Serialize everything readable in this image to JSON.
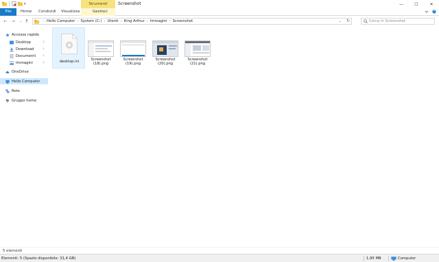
{
  "titlebar": {
    "contextual_tab": "Strumenti immagini",
    "window_title": "Screenshot",
    "minimize": "—",
    "maximize": "☐",
    "close": "✕"
  },
  "ribbon": {
    "tabs": [
      {
        "label": "File"
      },
      {
        "label": "Home"
      },
      {
        "label": "Condividi"
      },
      {
        "label": "Visualizza"
      },
      {
        "label": "Gestisci"
      }
    ]
  },
  "address": {
    "back": "←",
    "forward": "→",
    "recent": "⌄",
    "up": "↑",
    "crumbs": [
      "Hello Computer",
      "System (C:)",
      "Utenti",
      "King Arthur",
      "Immagini",
      "Screenshot"
    ],
    "refresh": "↻",
    "dropdown": "⌄"
  },
  "search": {
    "placeholder": "Cerca in Screenshot"
  },
  "nav": {
    "items": [
      {
        "label": "Accesso rapido",
        "icon": "star-icon"
      },
      {
        "label": "Desktop",
        "icon": "desktop-folder-icon",
        "pinned": true
      },
      {
        "label": "Download",
        "icon": "download-folder-icon",
        "pinned": true
      },
      {
        "label": "Documenti",
        "icon": "documents-folder-icon",
        "pinned": true
      },
      {
        "label": "Immagini",
        "icon": "pictures-folder-icon",
        "pinned": true
      },
      {
        "label": "OneDrive",
        "icon": "cloud-icon"
      },
      {
        "label": "Hello Computer",
        "icon": "computer-icon",
        "selected": true
      },
      {
        "label": "Rete",
        "icon": "network-icon"
      },
      {
        "label": "Gruppo home",
        "icon": "homegroup-icon"
      }
    ],
    "pin_glyph": "⊥"
  },
  "files": [
    {
      "name": "desktop.ini",
      "type": "ini",
      "selected": true
    },
    {
      "name": "Screenshot\n(18).png",
      "line1": "Screenshot",
      "line2": "(18).png",
      "type": "png"
    },
    {
      "name": "Screenshot\n(19).png",
      "line1": "Screenshot",
      "line2": "(19).png",
      "type": "png"
    },
    {
      "name": "Screenshot\n(20).png",
      "line1": "Screenshot",
      "line2": "(20).png",
      "type": "png-dark"
    },
    {
      "name": "Screenshot\n(21).png",
      "line1": "Screenshot",
      "line2": "(21).png",
      "type": "png"
    }
  ],
  "status": {
    "item_count": "5 elementi",
    "details": "Elementi: 5 (Spazio disponibile: 31,4 GB)",
    "size": "1,95 MB",
    "location": "Computer"
  },
  "colors": {
    "accent": "#1979ca",
    "contextual": "#f6e27f",
    "selection": "#cce8ff",
    "folder": "#f4c542"
  }
}
